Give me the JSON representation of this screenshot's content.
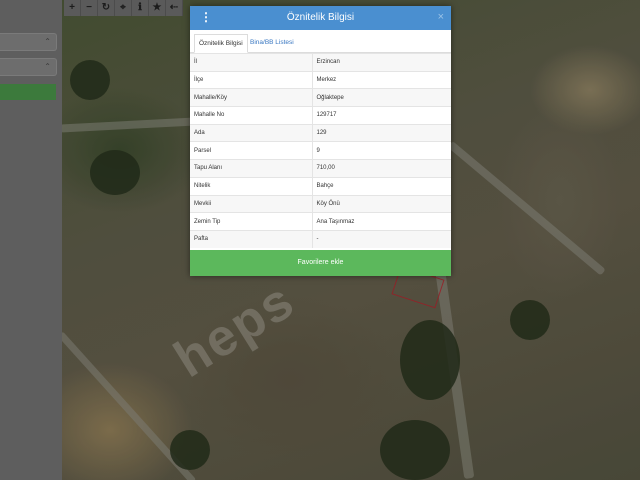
{
  "toolbar": {
    "buttons": [
      {
        "name": "zoom-in",
        "glyph": "+"
      },
      {
        "name": "zoom-out",
        "glyph": "−"
      },
      {
        "name": "refresh",
        "glyph": "↻"
      },
      {
        "name": "locate",
        "glyph": "⌖"
      },
      {
        "name": "info",
        "glyph": "ℹ"
      },
      {
        "name": "favorite",
        "glyph": "★"
      },
      {
        "name": "back",
        "glyph": "⇠"
      }
    ]
  },
  "watermark": "heps",
  "dialog": {
    "title": "Öznitelik Bilgisi",
    "menu_glyph": "⋮",
    "close_glyph": "×",
    "tabs": [
      "Öznitelik Bilgisi",
      "Bina/BB Listesi"
    ],
    "rows": [
      {
        "label": "İl",
        "value": "Erzincan"
      },
      {
        "label": "İlçe",
        "value": "Merkez"
      },
      {
        "label": "Mahalle/Köy",
        "value": "Oğlaktepe"
      },
      {
        "label": "Mahalle No",
        "value": "129717"
      },
      {
        "label": "Ada",
        "value": "129"
      },
      {
        "label": "Parsel",
        "value": "9"
      },
      {
        "label": "Tapu Alanı",
        "value": "710,00"
      },
      {
        "label": "Nitelik",
        "value": "Bahçe"
      },
      {
        "label": "Mevkii",
        "value": "Köy Önü"
      },
      {
        "label": "Zemin Tip",
        "value": "Ana Taşınmaz"
      },
      {
        "label": "Pafta",
        "value": "-"
      }
    ],
    "favorite_button": "Favorilere ekle"
  },
  "colors": {
    "header": "#4a8fd0",
    "favorite_button": "#5cb85c",
    "sidebar_button": "#3c7a3c"
  }
}
